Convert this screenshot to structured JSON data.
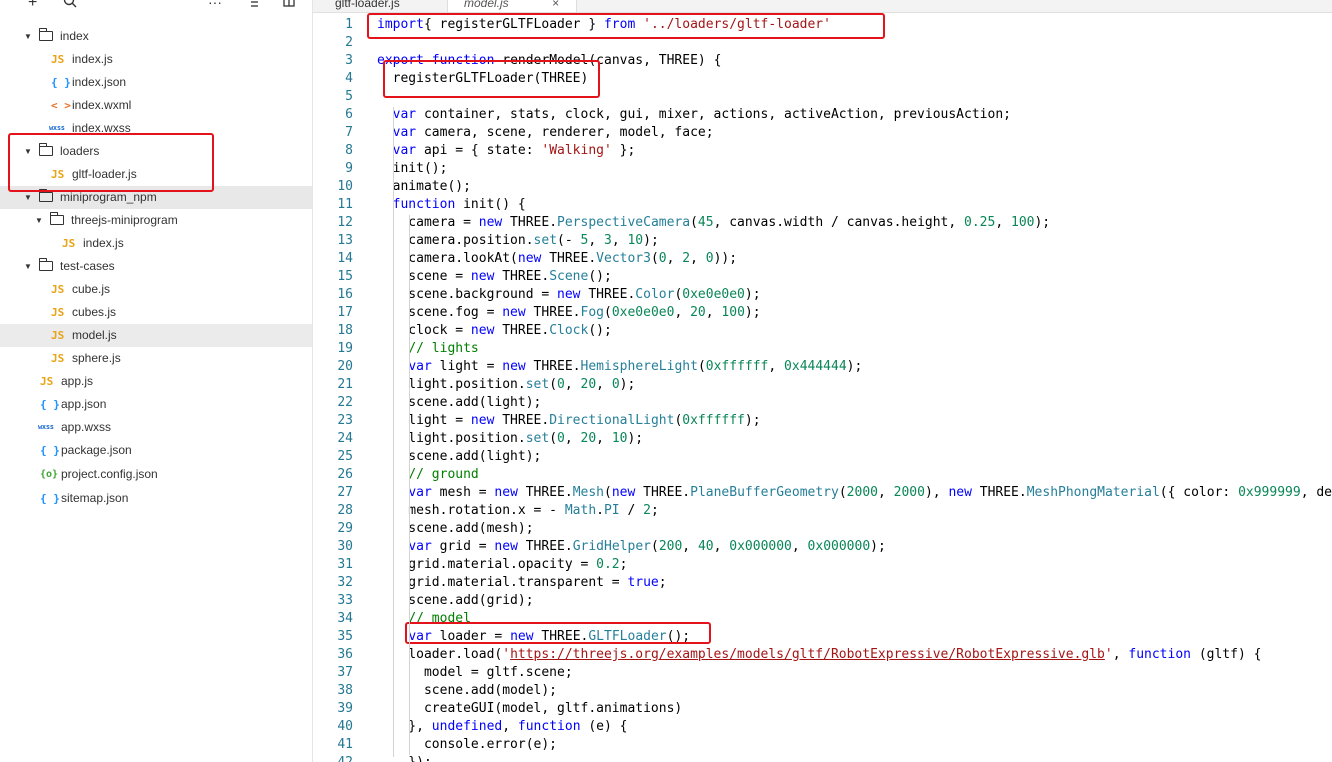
{
  "sidebar": {
    "toolbar": {
      "add_icon": "+",
      "search_icon": "search",
      "more_icon": "···",
      "collapse_icon": "collapse",
      "split_icon": "split"
    },
    "tree": [
      {
        "type": "folder",
        "label": "index",
        "level": 0,
        "expanded": true
      },
      {
        "type": "js",
        "icon": "JS",
        "label": "index.js",
        "level": 1
      },
      {
        "type": "json",
        "icon": "{ }",
        "label": "index.json",
        "level": 1
      },
      {
        "type": "wxml",
        "icon": "< >",
        "label": "index.wxml",
        "level": 1
      },
      {
        "type": "wxss",
        "icon": "wxss",
        "label": "index.wxss",
        "level": 1
      },
      {
        "type": "folder",
        "label": "loaders",
        "level": 0,
        "expanded": true
      },
      {
        "type": "js",
        "icon": "JS",
        "label": "gltf-loader.js",
        "level": 1
      },
      {
        "type": "folder",
        "label": "miniprogram_npm",
        "level": 0,
        "expanded": true
      },
      {
        "type": "folder",
        "label": "threejs-miniprogram",
        "level": 1,
        "expanded": true
      },
      {
        "type": "js",
        "icon": "JS",
        "label": "index.js",
        "level": 2
      },
      {
        "type": "folder",
        "label": "test-cases",
        "level": 0,
        "expanded": true
      },
      {
        "type": "js",
        "icon": "JS",
        "label": "cube.js",
        "level": 1
      },
      {
        "type": "js",
        "icon": "JS",
        "label": "cubes.js",
        "level": 1
      },
      {
        "type": "js",
        "icon": "JS",
        "label": "model.js",
        "level": 1
      },
      {
        "type": "js",
        "icon": "JS",
        "label": "sphere.js",
        "level": 1
      },
      {
        "type": "js",
        "icon": "JS",
        "label": "app.js",
        "level": 0
      },
      {
        "type": "json",
        "icon": "{ }",
        "label": "app.json",
        "level": 0
      },
      {
        "type": "wxss",
        "icon": "wxss",
        "label": "app.wxss",
        "level": 0
      },
      {
        "type": "json",
        "icon": "{ }",
        "label": "package.json",
        "level": 0
      },
      {
        "type": "cfg",
        "icon": "{o}",
        "label": "project.config.json",
        "level": 0
      },
      {
        "type": "json",
        "icon": "{ }",
        "label": "sitemap.json",
        "level": 0
      }
    ]
  },
  "tabs": [
    {
      "label": "gltf-loader.js",
      "active": false
    },
    {
      "label": "model.js",
      "active": true,
      "close": "×"
    }
  ],
  "editor": {
    "lines": [
      [
        [
          "kw",
          "import"
        ],
        [
          "",
          "{ registerGLTFLoader } "
        ],
        [
          "kw",
          "from"
        ],
        [
          "",
          " "
        ],
        [
          "str",
          "'../loaders/gltf-loader'"
        ]
      ],
      [],
      [
        [
          "kw",
          "export"
        ],
        [
          "",
          " "
        ],
        [
          "kw",
          "function"
        ],
        [
          "",
          " renderModel(canvas, THREE) {"
        ]
      ],
      [
        [
          "",
          "  registerGLTFLoader(THREE)"
        ]
      ],
      [],
      [
        [
          "",
          "  "
        ],
        [
          "kw",
          "var"
        ],
        [
          "",
          " container, stats, clock, gui, mixer, actions, activeAction, previousAction;"
        ]
      ],
      [
        [
          "",
          "  "
        ],
        [
          "kw",
          "var"
        ],
        [
          "",
          " camera, scene, renderer, model, face;"
        ]
      ],
      [
        [
          "",
          "  "
        ],
        [
          "kw",
          "var"
        ],
        [
          "",
          " api = { state: "
        ],
        [
          "str",
          "'Walking'"
        ],
        [
          "",
          " };"
        ]
      ],
      [
        [
          "",
          "  init();"
        ]
      ],
      [
        [
          "",
          "  animate();"
        ]
      ],
      [
        [
          "",
          "  "
        ],
        [
          "kw",
          "function"
        ],
        [
          "",
          " init() {"
        ]
      ],
      [
        [
          "",
          "    camera = "
        ],
        [
          "kw",
          "new"
        ],
        [
          "",
          " THREE."
        ],
        [
          "ty",
          "PerspectiveCamera"
        ],
        [
          "",
          "("
        ],
        [
          "num",
          "45"
        ],
        [
          "",
          ", canvas.width / canvas.height, "
        ],
        [
          "num",
          "0.25"
        ],
        [
          "",
          ", "
        ],
        [
          "num",
          "100"
        ],
        [
          "",
          ");"
        ]
      ],
      [
        [
          "",
          "    camera.position."
        ],
        [
          "ty",
          "set"
        ],
        [
          "",
          "(- "
        ],
        [
          "num",
          "5"
        ],
        [
          "",
          ", "
        ],
        [
          "num",
          "3"
        ],
        [
          "",
          ", "
        ],
        [
          "num",
          "10"
        ],
        [
          "",
          ");"
        ]
      ],
      [
        [
          "",
          "    camera.lookAt("
        ],
        [
          "kw",
          "new"
        ],
        [
          "",
          " THREE."
        ],
        [
          "ty",
          "Vector3"
        ],
        [
          "",
          "("
        ],
        [
          "num",
          "0"
        ],
        [
          "",
          ", "
        ],
        [
          "num",
          "2"
        ],
        [
          "",
          ", "
        ],
        [
          "num",
          "0"
        ],
        [
          "",
          "));"
        ]
      ],
      [
        [
          "",
          "    scene = "
        ],
        [
          "kw",
          "new"
        ],
        [
          "",
          " THREE."
        ],
        [
          "ty",
          "Scene"
        ],
        [
          "",
          "();"
        ]
      ],
      [
        [
          "",
          "    scene.background = "
        ],
        [
          "kw",
          "new"
        ],
        [
          "",
          " THREE."
        ],
        [
          "ty",
          "Color"
        ],
        [
          "",
          "("
        ],
        [
          "num",
          "0xe0e0e0"
        ],
        [
          "",
          ");"
        ]
      ],
      [
        [
          "",
          "    scene.fog = "
        ],
        [
          "kw",
          "new"
        ],
        [
          "",
          " THREE."
        ],
        [
          "ty",
          "Fog"
        ],
        [
          "",
          "("
        ],
        [
          "num",
          "0xe0e0e0"
        ],
        [
          "",
          ", "
        ],
        [
          "num",
          "20"
        ],
        [
          "",
          ", "
        ],
        [
          "num",
          "100"
        ],
        [
          "",
          ");"
        ]
      ],
      [
        [
          "",
          "    clock = "
        ],
        [
          "kw",
          "new"
        ],
        [
          "",
          " THREE."
        ],
        [
          "ty",
          "Clock"
        ],
        [
          "",
          "();"
        ]
      ],
      [
        [
          "",
          "    "
        ],
        [
          "cm",
          "// lights"
        ]
      ],
      [
        [
          "",
          "    "
        ],
        [
          "kw",
          "var"
        ],
        [
          "",
          " light = "
        ],
        [
          "kw",
          "new"
        ],
        [
          "",
          " THREE."
        ],
        [
          "ty",
          "HemisphereLight"
        ],
        [
          "",
          "("
        ],
        [
          "num",
          "0xffffff"
        ],
        [
          "",
          ", "
        ],
        [
          "num",
          "0x444444"
        ],
        [
          "",
          ");"
        ]
      ],
      [
        [
          "",
          "    light.position."
        ],
        [
          "ty",
          "set"
        ],
        [
          "",
          "("
        ],
        [
          "num",
          "0"
        ],
        [
          "",
          ", "
        ],
        [
          "num",
          "20"
        ],
        [
          "",
          ", "
        ],
        [
          "num",
          "0"
        ],
        [
          "",
          ");"
        ]
      ],
      [
        [
          "",
          "    scene.add(light);"
        ]
      ],
      [
        [
          "",
          "    light = "
        ],
        [
          "kw",
          "new"
        ],
        [
          "",
          " THREE."
        ],
        [
          "ty",
          "DirectionalLight"
        ],
        [
          "",
          "("
        ],
        [
          "num",
          "0xffffff"
        ],
        [
          "",
          ");"
        ]
      ],
      [
        [
          "",
          "    light.position."
        ],
        [
          "ty",
          "set"
        ],
        [
          "",
          "("
        ],
        [
          "num",
          "0"
        ],
        [
          "",
          ", "
        ],
        [
          "num",
          "20"
        ],
        [
          "",
          ", "
        ],
        [
          "num",
          "10"
        ],
        [
          "",
          ");"
        ]
      ],
      [
        [
          "",
          "    scene.add(light);"
        ]
      ],
      [
        [
          "",
          "    "
        ],
        [
          "cm",
          "// ground"
        ]
      ],
      [
        [
          "",
          "    "
        ],
        [
          "kw",
          "var"
        ],
        [
          "",
          " mesh = "
        ],
        [
          "kw",
          "new"
        ],
        [
          "",
          " THREE."
        ],
        [
          "ty",
          "Mesh"
        ],
        [
          "",
          "("
        ],
        [
          "kw",
          "new"
        ],
        [
          "",
          " THREE."
        ],
        [
          "ty",
          "PlaneBufferGeometry"
        ],
        [
          "",
          "("
        ],
        [
          "num",
          "2000"
        ],
        [
          "",
          ", "
        ],
        [
          "num",
          "2000"
        ],
        [
          "",
          "), "
        ],
        [
          "kw",
          "new"
        ],
        [
          "",
          " THREE."
        ],
        [
          "ty",
          "MeshPhongMaterial"
        ],
        [
          "",
          "({ color: "
        ],
        [
          "num",
          "0x999999"
        ],
        [
          "",
          ", dept"
        ]
      ],
      [
        [
          "",
          "    mesh.rotation.x = - "
        ],
        [
          "ty",
          "Math"
        ],
        [
          "",
          "."
        ],
        [
          "ty",
          "PI"
        ],
        [
          "",
          " / "
        ],
        [
          "num",
          "2"
        ],
        [
          "",
          ";"
        ]
      ],
      [
        [
          "",
          "    scene.add(mesh);"
        ]
      ],
      [
        [
          "",
          "    "
        ],
        [
          "kw",
          "var"
        ],
        [
          "",
          " grid = "
        ],
        [
          "kw",
          "new"
        ],
        [
          "",
          " THREE."
        ],
        [
          "ty",
          "GridHelper"
        ],
        [
          "",
          "("
        ],
        [
          "num",
          "200"
        ],
        [
          "",
          ", "
        ],
        [
          "num",
          "40"
        ],
        [
          "",
          ", "
        ],
        [
          "num",
          "0x000000"
        ],
        [
          "",
          ", "
        ],
        [
          "num",
          "0x000000"
        ],
        [
          "",
          ");"
        ]
      ],
      [
        [
          "",
          "    grid.material.opacity = "
        ],
        [
          "num",
          "0.2"
        ],
        [
          "",
          ";"
        ]
      ],
      [
        [
          "",
          "    grid.material.transparent = "
        ],
        [
          "kw",
          "true"
        ],
        [
          "",
          ";"
        ]
      ],
      [
        [
          "",
          "    scene.add(grid);"
        ]
      ],
      [
        [
          "",
          "    "
        ],
        [
          "cm",
          "// model"
        ]
      ],
      [
        [
          "",
          "    "
        ],
        [
          "kw",
          "var"
        ],
        [
          "",
          " loader = "
        ],
        [
          "kw",
          "new"
        ],
        [
          "",
          " THREE."
        ],
        [
          "ty",
          "GLTFLoader"
        ],
        [
          "",
          "();"
        ]
      ],
      [
        [
          "",
          "    loader.load("
        ],
        [
          "str",
          "'"
        ],
        [
          "url",
          "https://threejs.org/examples/models/gltf/RobotExpressive/RobotExpressive.glb"
        ],
        [
          "str",
          "'"
        ],
        [
          "",
          ", "
        ],
        [
          "kw",
          "function"
        ],
        [
          "",
          " (gltf) {"
        ]
      ],
      [
        [
          "",
          "      model = gltf.scene;"
        ]
      ],
      [
        [
          "",
          "      scene.add(model);"
        ]
      ],
      [
        [
          "",
          "      createGUI(model, gltf.animations)"
        ]
      ],
      [
        [
          "",
          "    }, "
        ],
        [
          "kw",
          "undefined"
        ],
        [
          "",
          ", "
        ],
        [
          "kw",
          "function"
        ],
        [
          "",
          " (e) {"
        ]
      ],
      [
        [
          "",
          "      console.error(e);"
        ]
      ],
      [
        [
          "",
          "    });"
        ]
      ]
    ]
  }
}
